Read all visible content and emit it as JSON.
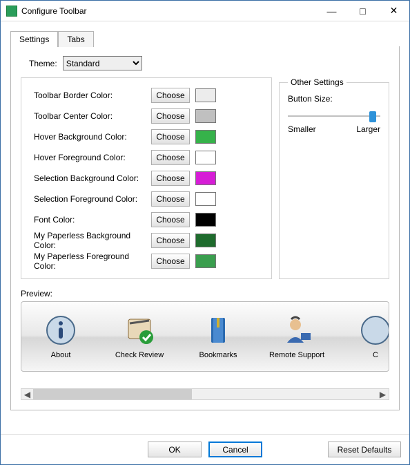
{
  "window": {
    "title": "Configure Toolbar"
  },
  "tabs": [
    {
      "label": "Settings",
      "active": true
    },
    {
      "label": "Tabs",
      "active": false
    }
  ],
  "theme": {
    "label": "Theme:",
    "selected": "Standard"
  },
  "color_rows": [
    {
      "label": "Toolbar Border Color:",
      "button": "Choose",
      "swatch": "#ececec"
    },
    {
      "label": "Toolbar Center Color:",
      "button": "Choose",
      "swatch": "#c0c0c0"
    },
    {
      "label": "Hover Background Color:",
      "button": "Choose",
      "swatch": "#36b24a"
    },
    {
      "label": "Hover Foreground Color:",
      "button": "Choose",
      "swatch": "#ffffff"
    },
    {
      "label": "Selection Background Color:",
      "button": "Choose",
      "swatch": "#d61dd6"
    },
    {
      "label": "Selection Foreground Color:",
      "button": "Choose",
      "swatch": "#ffffff"
    },
    {
      "label": "Font Color:",
      "button": "Choose",
      "swatch": "#000000"
    },
    {
      "label": "My Paperless Background Color:",
      "button": "Choose",
      "swatch": "#1e6b2d"
    },
    {
      "label": "My Paperless Foreground Color:",
      "button": "Choose",
      "swatch": "#3a9e4e"
    }
  ],
  "other": {
    "legend": "Other Settings",
    "button_size_label": "Button Size:",
    "smaller": "Smaller",
    "larger": "Larger",
    "slider_value": 100
  },
  "preview": {
    "label": "Preview:",
    "items": [
      {
        "label": "About",
        "icon": "info"
      },
      {
        "label": "Check Review",
        "icon": "check"
      },
      {
        "label": "Bookmarks",
        "icon": "book"
      },
      {
        "label": "Remote Support",
        "icon": "person"
      },
      {
        "label": "C",
        "icon": "circle"
      }
    ]
  },
  "footer": {
    "ok": "OK",
    "cancel": "Cancel",
    "reset": "Reset Defaults"
  }
}
